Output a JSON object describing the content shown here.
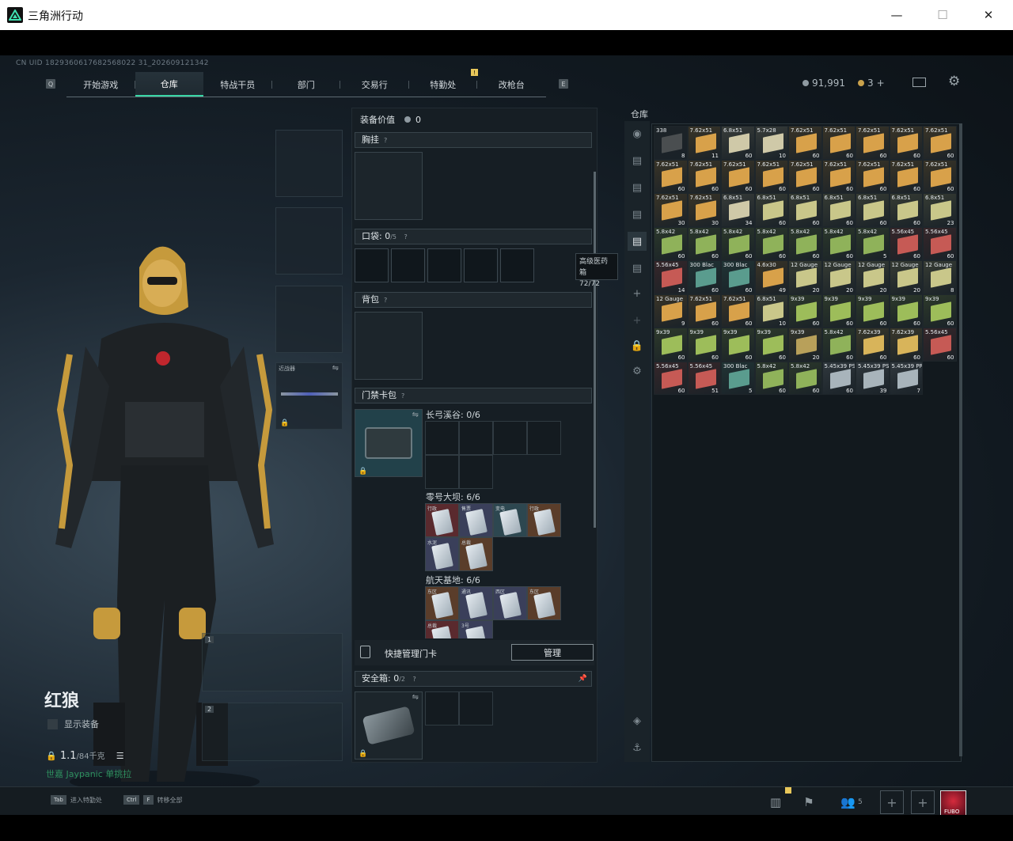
{
  "window": {
    "title": "三角洲行动",
    "minimize": "—",
    "maximize": "☐",
    "close": "✕"
  },
  "uid": "CN UID 1829360617682568022 31_202609121342",
  "nav": {
    "left_key": "Q",
    "right_key": "E",
    "tabs": [
      "开始游戏",
      "仓库",
      "特战干员",
      "部门",
      "交易行",
      "特勤处",
      "改枪台"
    ],
    "active": "仓库",
    "notif_badge": "!"
  },
  "currency": {
    "coins": "91,991",
    "tickets": "3",
    "add": "+"
  },
  "operator": {
    "name": "红狼",
    "show_equipment": "显示装备",
    "weight": "1.1",
    "weight_max": "/84千克",
    "partner_line": "世嘉 Jaypanic 单挑拉"
  },
  "melee_slot": {
    "label": "近战器"
  },
  "gun_slots": [
    "1",
    "2"
  ],
  "equipment": {
    "value_label": "装备价值",
    "value": "0",
    "chest_rig": "胸挂",
    "pockets": "口袋:",
    "pockets_count": "0",
    "pockets_max": "/5",
    "backpack": "背包",
    "keycard_wallet": "门禁卡包",
    "maps": [
      {
        "name": "长弓溪谷",
        "count": "0/6"
      },
      {
        "name": "零号大坝",
        "count": "6/6"
      },
      {
        "name": "航天基地",
        "count": "6/6"
      }
    ],
    "dam_cards": [
      "行政",
      "售票",
      "变电",
      "行政",
      "水泥",
      "总裁"
    ],
    "space_cards": [
      "东区",
      "通讯",
      "西区",
      "东区",
      "总裁",
      "3号"
    ],
    "quick_manage": "快捷管理门卡",
    "manage_btn": "管理",
    "safe_box": "安全箱:",
    "safe_count": "0",
    "safe_max": "/2",
    "qmark": "?"
  },
  "tooltip": {
    "title": "高级医药箱",
    "value": "72/72"
  },
  "warehouse": {
    "label": "仓库",
    "items": [
      {
        "cal": "338",
        "qty": "8",
        "c": "#4a4e50"
      },
      {
        "cal": "7.62x51",
        "qty": "11",
        "c": "#d8a14a"
      },
      {
        "cal": "6.8x51",
        "qty": "60",
        "c": "#cfc9a8"
      },
      {
        "cal": "5.7x28",
        "qty": "10",
        "c": "#cfc9a8"
      },
      {
        "cal": "7.62x51",
        "qty": "60",
        "c": "#d8a14a"
      },
      {
        "cal": "7.62x51",
        "qty": "60",
        "c": "#d8a14a"
      },
      {
        "cal": "7.62x51",
        "qty": "60",
        "c": "#d8a14a"
      },
      {
        "cal": "7.62x51",
        "qty": "60",
        "c": "#d8a14a"
      },
      {
        "cal": "7.62x51",
        "qty": "60",
        "c": "#d8a14a"
      },
      {
        "cal": "7.62x51",
        "qty": "60",
        "c": "#d8a14a"
      },
      {
        "cal": "7.62x51",
        "qty": "60",
        "c": "#d8a14a"
      },
      {
        "cal": "7.62x51",
        "qty": "60",
        "c": "#d8a14a"
      },
      {
        "cal": "7.62x51",
        "qty": "60",
        "c": "#d8a14a"
      },
      {
        "cal": "7.62x51",
        "qty": "60",
        "c": "#d8a14a"
      },
      {
        "cal": "7.62x51",
        "qty": "60",
        "c": "#d8a14a"
      },
      {
        "cal": "7.62x51",
        "qty": "60",
        "c": "#d8a14a"
      },
      {
        "cal": "7.62x51",
        "qty": "60",
        "c": "#d8a14a"
      },
      {
        "cal": "7.62x51",
        "qty": "60",
        "c": "#d8a14a"
      },
      {
        "cal": "7.62x51",
        "qty": "30",
        "c": "#d8a14a"
      },
      {
        "cal": "7.62x51",
        "qty": "30",
        "c": "#d8a14a"
      },
      {
        "cal": "6.8x51",
        "qty": "34",
        "c": "#cfc9a8"
      },
      {
        "cal": "6.8x51",
        "qty": "60",
        "c": "#c9c78a"
      },
      {
        "cal": "6.8x51",
        "qty": "60",
        "c": "#c9c78a"
      },
      {
        "cal": "6.8x51",
        "qty": "60",
        "c": "#c9c78a"
      },
      {
        "cal": "6.8x51",
        "qty": "60",
        "c": "#c9c78a"
      },
      {
        "cal": "6.8x51",
        "qty": "60",
        "c": "#c9c78a"
      },
      {
        "cal": "6.8x51",
        "qty": "23",
        "c": "#c9c78a"
      },
      {
        "cal": "5.8x42",
        "qty": "60",
        "c": "#8fb25a"
      },
      {
        "cal": "5.8x42",
        "qty": "60",
        "c": "#8fb25a"
      },
      {
        "cal": "5.8x42",
        "qty": "60",
        "c": "#8fb25a"
      },
      {
        "cal": "5.8x42",
        "qty": "60",
        "c": "#8fb25a"
      },
      {
        "cal": "5.8x42",
        "qty": "60",
        "c": "#8fb25a"
      },
      {
        "cal": "5.8x42",
        "qty": "60",
        "c": "#8fb25a"
      },
      {
        "cal": "5.8x42",
        "qty": "5",
        "c": "#8fb25a"
      },
      {
        "cal": "5.56x45",
        "qty": "60",
        "c": "#c65a55"
      },
      {
        "cal": "5.56x45",
        "qty": "60",
        "c": "#c65a55"
      },
      {
        "cal": "5.56x45",
        "qty": "14",
        "c": "#c65a55"
      },
      {
        "cal": "300 Blac",
        "qty": "60",
        "c": "#5a9c8e"
      },
      {
        "cal": "300 Blac",
        "qty": "60",
        "c": "#5a9c8e"
      },
      {
        "cal": "4.6x30",
        "qty": "49",
        "c": "#d8a14a"
      },
      {
        "cal": "12 Gauge",
        "qty": "20",
        "c": "#c9c78a"
      },
      {
        "cal": "12 Gauge",
        "qty": "20",
        "c": "#c9c78a"
      },
      {
        "cal": "12 Gauge",
        "qty": "20",
        "c": "#c9c78a"
      },
      {
        "cal": "12 Gauge",
        "qty": "20",
        "c": "#c9c78a"
      },
      {
        "cal": "12 Gauge",
        "qty": "8",
        "c": "#c9c78a"
      },
      {
        "cal": "12 Gauge",
        "qty": "9",
        "c": "#d8a14a"
      },
      {
        "cal": "7.62x51",
        "qty": "60",
        "c": "#d8a14a"
      },
      {
        "cal": "7.62x51",
        "qty": "60",
        "c": "#d8a14a"
      },
      {
        "cal": "6.8x51",
        "qty": "10",
        "c": "#c9c78a"
      },
      {
        "cal": "9x39",
        "qty": "60",
        "c": "#9dbd5a"
      },
      {
        "cal": "9x39",
        "qty": "60",
        "c": "#9dbd5a"
      },
      {
        "cal": "9x39",
        "qty": "60",
        "c": "#9dbd5a"
      },
      {
        "cal": "9x39",
        "qty": "60",
        "c": "#9dbd5a"
      },
      {
        "cal": "9x39",
        "qty": "60",
        "c": "#9dbd5a"
      },
      {
        "cal": "9x39",
        "qty": "60",
        "c": "#9dbd5a"
      },
      {
        "cal": "9x39",
        "qty": "60",
        "c": "#9dbd5a"
      },
      {
        "cal": "9x39",
        "qty": "60",
        "c": "#9dbd5a"
      },
      {
        "cal": "9x39",
        "qty": "60",
        "c": "#9dbd5a"
      },
      {
        "cal": "9x39",
        "qty": "20",
        "c": "#b8a05a"
      },
      {
        "cal": "5.8x42",
        "qty": "60",
        "c": "#8fb25a"
      },
      {
        "cal": "7.62x39",
        "qty": "60",
        "c": "#d8b45a"
      },
      {
        "cal": "7.62x39",
        "qty": "60",
        "c": "#d8b45a"
      },
      {
        "cal": "5.56x45",
        "qty": "60",
        "c": "#c65a55"
      },
      {
        "cal": "5.56x45",
        "qty": "60",
        "c": "#c65a55"
      },
      {
        "cal": "5.56x45",
        "qty": "51",
        "c": "#c65a55"
      },
      {
        "cal": "300 Blac",
        "qty": "5",
        "c": "#5a9c8e"
      },
      {
        "cal": "5.8x42",
        "qty": "60",
        "c": "#8fb25a"
      },
      {
        "cal": "5.8x42",
        "qty": "60",
        "c": "#8fb25a"
      },
      {
        "cal": "5.45x39 PS",
        "qty": "60",
        "c": "#a8b4bb"
      },
      {
        "cal": "5.45x39 PS",
        "qty": "39",
        "c": "#a8b4bb"
      },
      {
        "cal": "5.45x39 PRS",
        "qty": "7",
        "c": "#a8b4bb"
      }
    ]
  },
  "bottom": {
    "tab_key": "Tab",
    "tab_hint": "进入特勤处",
    "ctrl_key": "Ctrl",
    "f_key": "F",
    "ctrl_hint": "转移全部",
    "squad_count": "5",
    "avatar_label": "FUBO"
  },
  "colors": {
    "accent": "#39d6a5",
    "tab_active_bg": "#26323a"
  }
}
